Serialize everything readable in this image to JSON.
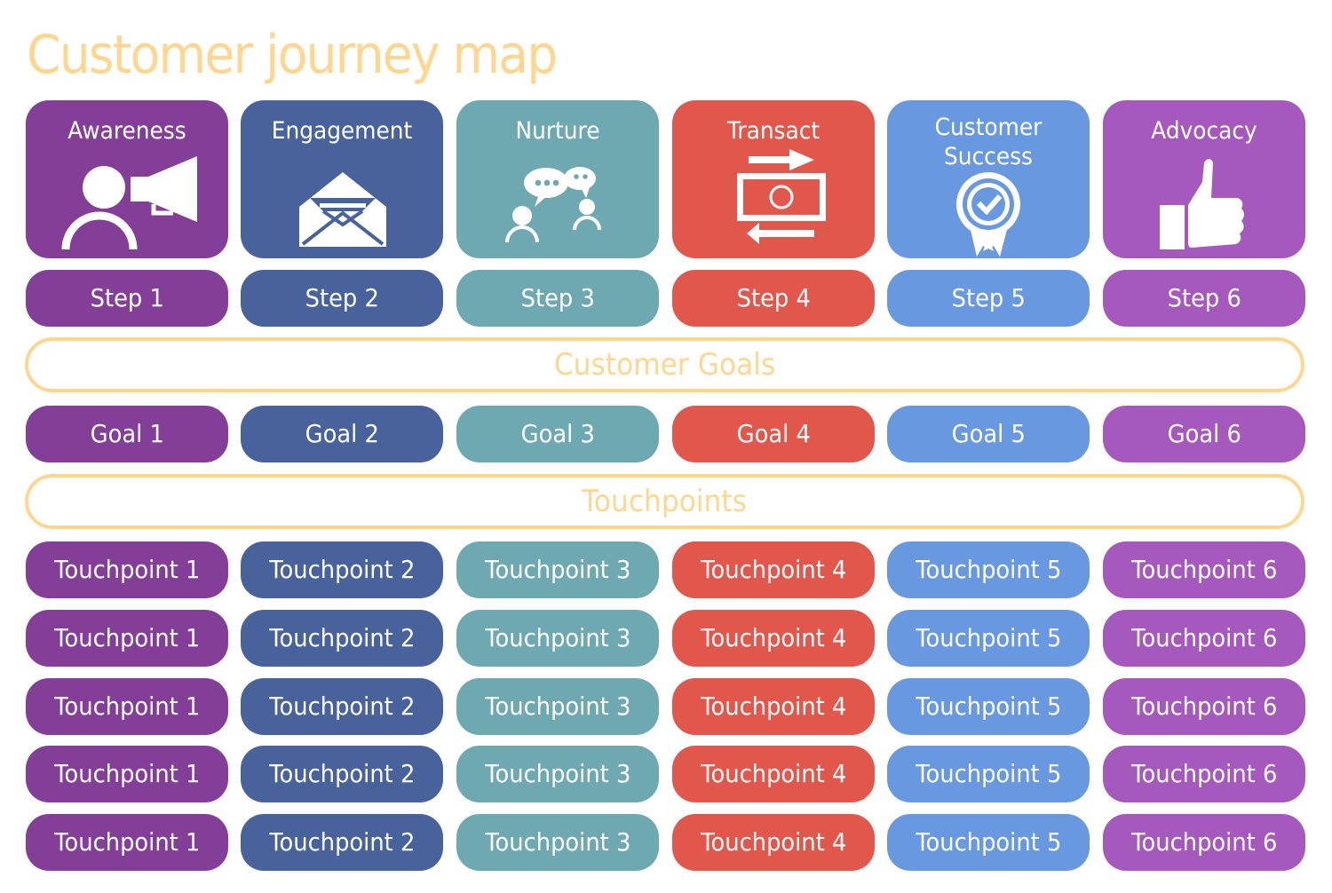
{
  "title": "Customer journey map",
  "colors": {
    "title": "#FFD68F",
    "band_border": "#FFD68F",
    "stages": [
      "#833F98",
      "#48629B",
      "#6EA8B0",
      "#E2574C",
      "#6899E0",
      "#A659BC"
    ]
  },
  "stages": [
    {
      "label": "Awareness",
      "icon": "megaphone-person-icon",
      "step": "Step 1",
      "goal": "Goal 1"
    },
    {
      "label": "Engagement",
      "icon": "open-envelope-icon",
      "step": "Step 2",
      "goal": "Goal 2"
    },
    {
      "label": "Nurture",
      "icon": "conversation-icon",
      "step": "Step 3",
      "goal": "Goal 3"
    },
    {
      "label": "Transact",
      "icon": "money-exchange-icon",
      "step": "Step 4",
      "goal": "Goal 4"
    },
    {
      "label": "Customer\nSuccess",
      "label_line1": "Customer",
      "label_line2": "Success",
      "icon": "award-badge-icon",
      "step": "Step 5",
      "goal": "Goal 5"
    },
    {
      "label": "Advocacy",
      "icon": "thumbs-up-icon",
      "step": "Step 6",
      "goal": "Goal 6"
    }
  ],
  "bands": {
    "goals": "Customer Goals",
    "touchpoints": "Touchpoints"
  },
  "touchpoints": [
    [
      "Touchpoint 1",
      "Touchpoint 2",
      "Touchpoint 3",
      "Touchpoint 4",
      "Touchpoint 5",
      "Touchpoint 6"
    ],
    [
      "Touchpoint 1",
      "Touchpoint 2",
      "Touchpoint 3",
      "Touchpoint 4",
      "Touchpoint 5",
      "Touchpoint 6"
    ],
    [
      "Touchpoint 1",
      "Touchpoint 2",
      "Touchpoint 3",
      "Touchpoint 4",
      "Touchpoint 5",
      "Touchpoint 6"
    ],
    [
      "Touchpoint 1",
      "Touchpoint 2",
      "Touchpoint 3",
      "Touchpoint 4",
      "Touchpoint 5",
      "Touchpoint 6"
    ],
    [
      "Touchpoint 1",
      "Touchpoint 2",
      "Touchpoint 3",
      "Touchpoint 4",
      "Touchpoint 5",
      "Touchpoint 6"
    ]
  ]
}
